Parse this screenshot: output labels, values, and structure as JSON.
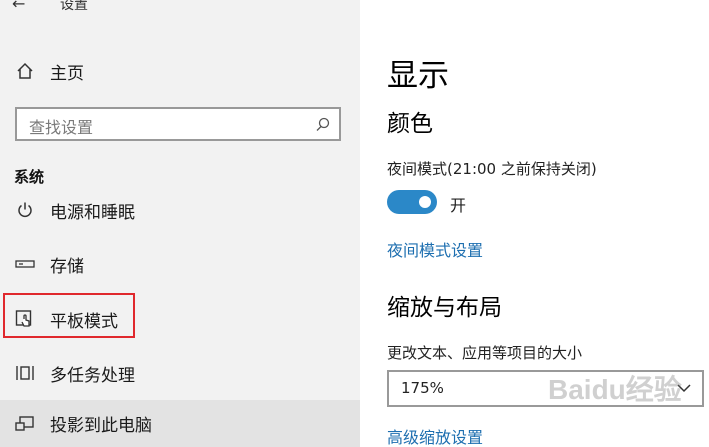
{
  "window": {
    "back_icon": "back-arrow-icon",
    "title": "设置"
  },
  "sidebar": {
    "home_label": "主页",
    "search_placeholder": "查找设置",
    "section_title": "系统",
    "items": [
      {
        "icon": "power-icon",
        "label": "电源和睡眠"
      },
      {
        "icon": "storage-icon",
        "label": "存储"
      },
      {
        "icon": "tablet-mode-icon",
        "label": "平板模式",
        "highlighted": true
      },
      {
        "icon": "multitasking-icon",
        "label": "多任务处理"
      },
      {
        "icon": "project-icon",
        "label": "投影到此电脑",
        "selected_bg": true
      }
    ]
  },
  "main": {
    "page_title": "显示",
    "color_section": {
      "title": "颜色",
      "night_light_label": "夜间模式(21:00 之前保持关闭)",
      "toggle_state": "开",
      "toggle_on": true,
      "night_light_link": "夜间模式设置"
    },
    "scale_section": {
      "title": "缩放与布局",
      "text_size_label": "更改文本、应用等项目的大小",
      "scale_value": "175%",
      "advanced_link": "高级缩放设置"
    }
  },
  "colors": {
    "accent": "#2b88c8",
    "link": "#1e6fb0",
    "highlight_border": "#e0282d"
  },
  "watermark": "Baidu经验"
}
